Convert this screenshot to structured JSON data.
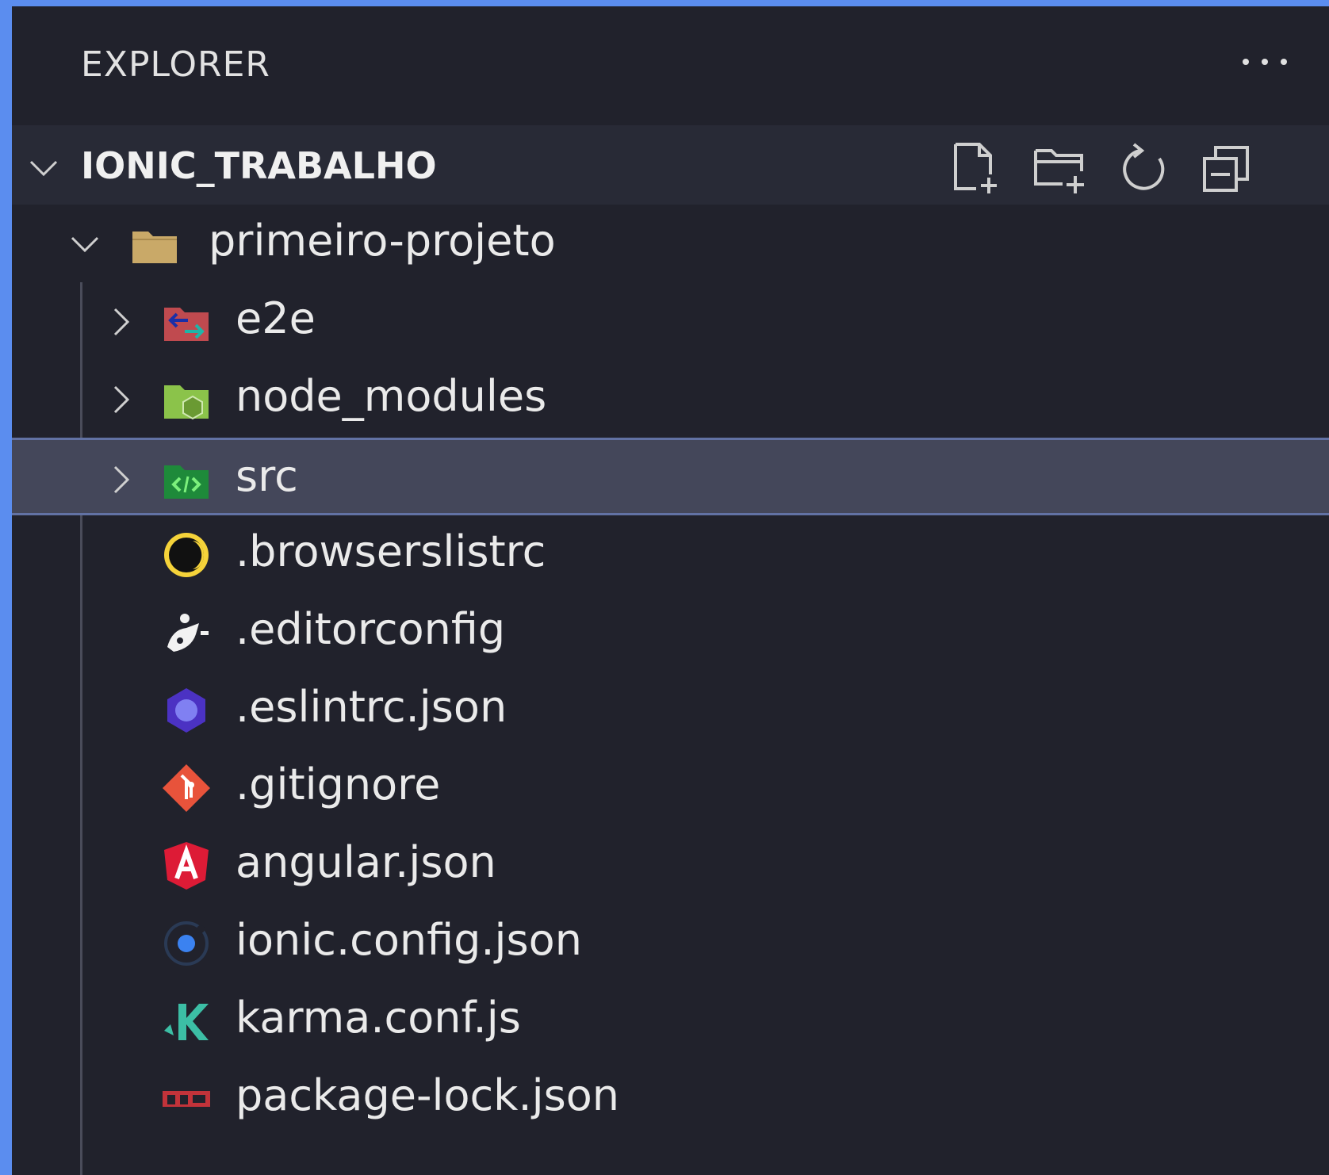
{
  "explorer": {
    "title": "EXPLORER"
  },
  "section": {
    "title": "IONIC_TRABALHO"
  },
  "toolbar": {
    "new_file": "new-file-icon",
    "new_folder": "new-folder-icon",
    "refresh": "refresh-icon",
    "collapse_all": "collapse-all-icon"
  },
  "tree": {
    "root": {
      "label": "primeiro-projeto",
      "icon": "folder-open-icon",
      "expanded": true
    },
    "items": [
      {
        "label": "e2e",
        "icon": "folder-e2e-icon",
        "type": "folder"
      },
      {
        "label": "node_modules",
        "icon": "folder-node-icon",
        "type": "folder"
      },
      {
        "label": "src",
        "icon": "folder-src-icon",
        "type": "folder",
        "selected": true
      },
      {
        "label": ".browserslistrc",
        "icon": "browserslist-icon",
        "type": "file"
      },
      {
        "label": ".editorconfig",
        "icon": "editorconfig-icon",
        "type": "file"
      },
      {
        "label": ".eslintrc.json",
        "icon": "eslint-icon",
        "type": "file"
      },
      {
        "label": ".gitignore",
        "icon": "git-icon",
        "type": "file"
      },
      {
        "label": "angular.json",
        "icon": "angular-icon",
        "type": "file"
      },
      {
        "label": "ionic.config.json",
        "icon": "ionic-icon",
        "type": "file"
      },
      {
        "label": "karma.conf.js",
        "icon": "karma-icon",
        "type": "file"
      },
      {
        "label": "package-lock.json",
        "icon": "npm-icon",
        "type": "file"
      }
    ]
  },
  "colors": {
    "frame": "#5b8def",
    "panel": "#21222c",
    "section_header": "#282a36",
    "selection": "#44475a",
    "selection_border": "#6272a4"
  }
}
